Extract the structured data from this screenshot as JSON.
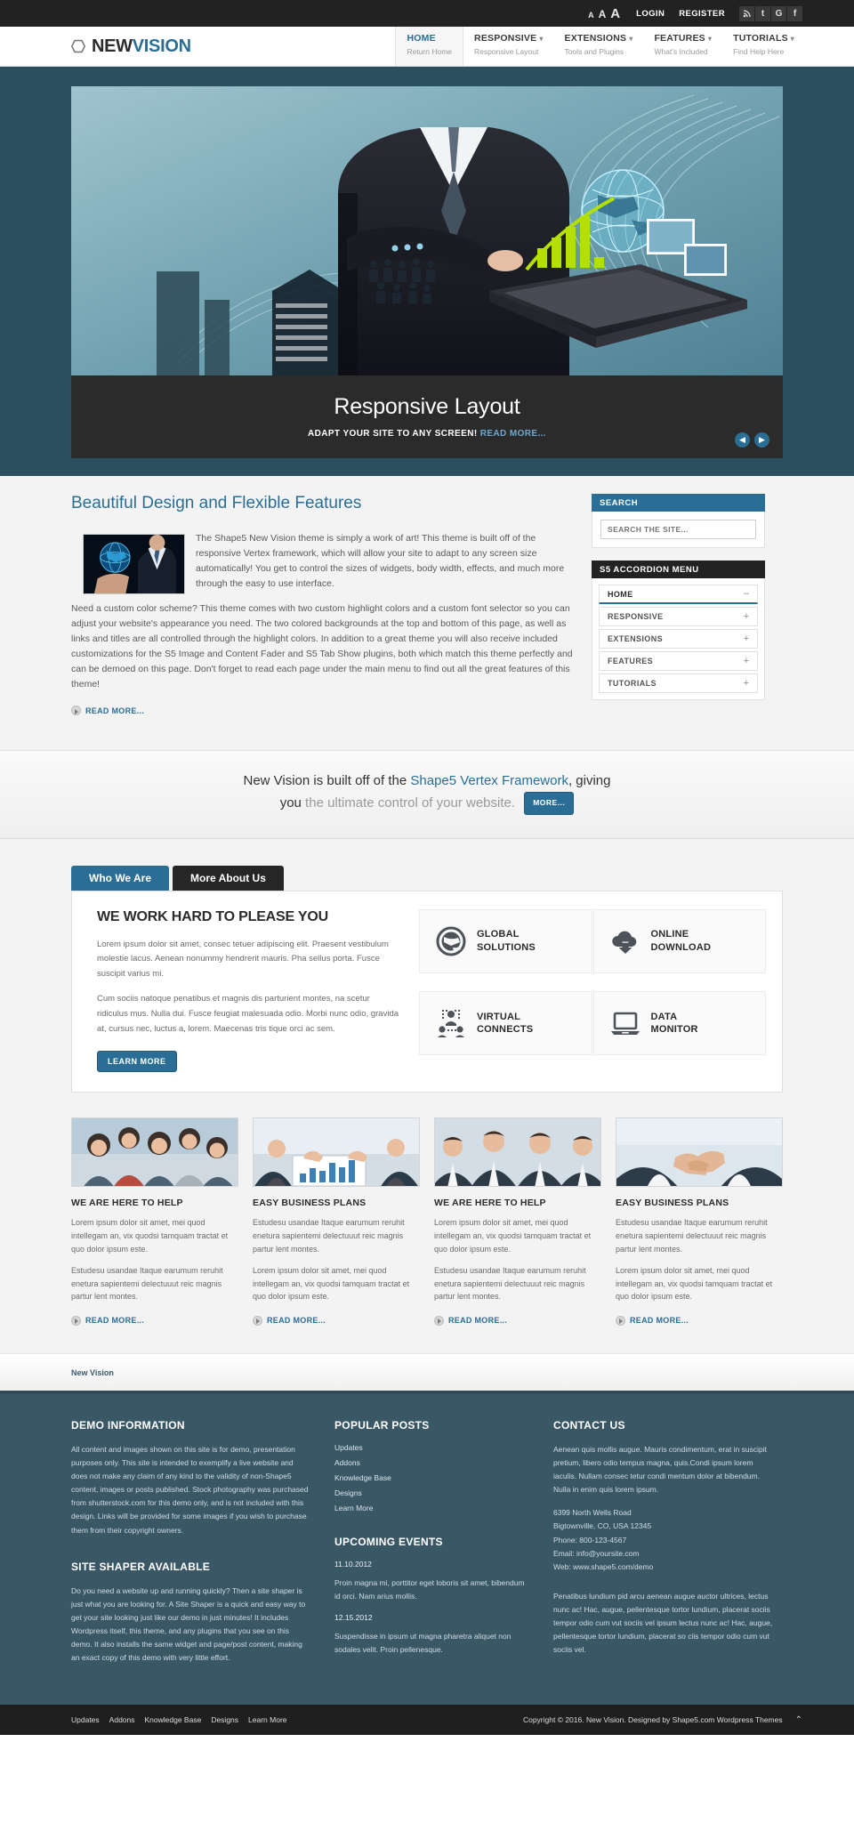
{
  "topbar": {
    "font_sizes": [
      "A",
      "A",
      "A"
    ],
    "login_label": "LOGIN",
    "register_label": "REGISTER",
    "social": [
      {
        "name": "rss-icon",
        "glyph": "◔"
      },
      {
        "name": "twitter-icon",
        "glyph": "t"
      },
      {
        "name": "google-icon",
        "glyph": "G"
      },
      {
        "name": "facebook-icon",
        "glyph": "f"
      }
    ]
  },
  "header": {
    "logo_a": "NEW",
    "logo_b": "VISION",
    "nav": [
      {
        "label": "HOME",
        "sub": "Return Home",
        "caret": false,
        "active": true
      },
      {
        "label": "RESPONSIVE",
        "sub": "Responsive Layout",
        "caret": true,
        "active": false
      },
      {
        "label": "EXTENSIONS",
        "sub": "Tools and Plugins",
        "caret": true,
        "active": false
      },
      {
        "label": "FEATURES",
        "sub": "What's Included",
        "caret": true,
        "active": false
      },
      {
        "label": "TUTORIALS",
        "sub": "Find Help Here",
        "caret": true,
        "active": false
      }
    ]
  },
  "slider": {
    "title": "Responsive Layout",
    "subtitle": "ADAPT YOUR SITE TO ANY SCREEN!",
    "read_more": "READ MORE...",
    "prev": "◀",
    "next": "▶"
  },
  "main": {
    "page_title": "Beautiful Design and Flexible Features",
    "paragraph_1": "The Shape5 New Vision theme is simply a work of art! This theme is built off of the responsive Vertex framework, which will allow your site to adapt to any screen size automatically! You get to control the sizes of widgets, body width, effects, and much more through the easy to use interface.",
    "paragraph_2": "Need a custom color scheme? This theme comes with two custom highlight colors and a custom font selector so you can adjust your website's appearance you need. The two colored backgrounds at the top and bottom of this page, as well as links and titles are all controlled through the highlight colors. In addition to a great theme you will also receive included customizations for the S5 Image and Content Fader and S5 Tab Show plugins, both which match this theme perfectly and can be demoed on this page. Don't forget to read each page under the main menu to find out all the great features of this theme!",
    "read_more": "READ MORE..."
  },
  "sidebar": {
    "search_title": "SEARCH",
    "search_placeholder": "SEARCH THE SITE...",
    "search_value": "",
    "accordion_title": "S5 ACCORDION MENU",
    "accordion_items": [
      {
        "label": "HOME",
        "sign": "–"
      },
      {
        "label": "RESPONSIVE",
        "sign": "+"
      },
      {
        "label": "EXTENSIONS",
        "sign": "+"
      },
      {
        "label": "FEATURES",
        "sign": "+"
      },
      {
        "label": "TUTORIALS",
        "sign": "+"
      }
    ]
  },
  "highlight": {
    "line1_a": "New Vision is built off of the ",
    "line1_link": "Shape5 Vertex Framework",
    "line1_b": ", giving",
    "line2_a": "you",
    "line2_b": " the ultimate control of your website.",
    "button": "MORE..."
  },
  "tabs": {
    "tab_active": "Who We Are",
    "tab_inactive": "More About Us",
    "panel_title": "WE WORK HARD TO PLEASE YOU",
    "panel_p1": "Lorem ipsum dolor sit amet, consec tetuer adipiscing elit. Praesent vestibulum molestie lacus. Aenean nonummy hendrerit mauris. Pha sellus porta. Fusce suscipit varius mi.",
    "panel_p2": "Cum sociis natoque penatibus et magnis dis parturient montes, na scetur ridiculus mus. Nulla dui. Fusce feugiat malesuada odio. Morbi nunc odio, gravida at, cursus nec, luctus a, lorem. Maecenas tris tique orci ac sem.",
    "learn_more": "LEARN MORE",
    "features": [
      {
        "icon": "globe-icon",
        "line1": "GLOBAL",
        "line2": "SOLUTIONS"
      },
      {
        "icon": "cloud-download-icon",
        "line1": "ONLINE",
        "line2": "DOWNLOAD"
      },
      {
        "icon": "users-network-icon",
        "line1": "VIRTUAL",
        "line2": "CONNECTS"
      },
      {
        "icon": "laptop-icon",
        "line1": "DATA",
        "line2": "MONITOR"
      }
    ]
  },
  "blog": {
    "read_more": "READ MORE...",
    "columns": [
      {
        "image": "group-selfie-photo",
        "title": "WE ARE HERE TO HELP",
        "p1": "Lorem ipsum dolor sit amet, mei quod intellegam an, vix quodsi tamquam tractat et quo dolor ipsum este.",
        "p2": "Estudesu usandae Itaque earumum reruhit enetura sapientemi delectuuut reic magnis partur lent montes."
      },
      {
        "image": "meeting-chart-photo",
        "title": "EASY BUSINESS PLANS",
        "p1": "Estudesu usandae Itaque earumum reruhit enetura sapientemi delectuuut reic magnis partur lent montes.",
        "p2": "Lorem ipsum dolor sit amet, mei quod intellegam an, vix quodsi tamquam tractat et quo dolor ipsum este."
      },
      {
        "image": "business-team-photo",
        "title": "WE ARE HERE TO HELP",
        "p1": "Lorem ipsum dolor sit amet, mei quod intellegam an, vix quodsi tamquam tractat et quo dolor ipsum este.",
        "p2": "Estudesu usandae Itaque earumum reruhit enetura sapientemi delectuuut reic magnis partur lent montes."
      },
      {
        "image": "handshake-photo",
        "title": "EASY BUSINESS PLANS",
        "p1": "Estudesu usandae Itaque earumum reruhit enetura sapientemi delectuuut reic magnis partur lent montes.",
        "p2": "Lorem ipsum dolor sit amet, mei quod intellegam an, vix quodsi tamquam tractat et quo dolor ipsum este."
      }
    ]
  },
  "breadcrumb": {
    "text": "New Vision"
  },
  "footer": {
    "demo_title": "DEMO INFORMATION",
    "demo_text": "All content and images shown on this site is for demo, presentation purposes only. This site is intended to exemplify a live website and does not make any claim of any kind to the validity of non-Shape5 content, images or posts published. Stock photography was purchased from shutterstock.com for this demo only, and is not included with this design. Links will be provided for some images if you wish to purchase them from their copyright owners.",
    "shaper_title": "SITE SHAPER AVAILABLE",
    "shaper_text": "Do you need a website up and running quickly? Then a site shaper is just what you are looking for. A Site Shaper is a quick and easy way to get your site looking just like our demo in just minutes! It includes Wordpress itself, this theme, and any plugins that you see on this demo. It also installs the same widget and page/post content, making an exact copy of this demo with very little effort.",
    "popular_title": "POPULAR POSTS",
    "popular_links": [
      "Updates",
      "Addons",
      "Knowledge Base",
      "Designs",
      "Learn More"
    ],
    "events_title": "UPCOMING EVENTS",
    "events": [
      {
        "date": "11.10.2012",
        "text": "Proin magna mi, porttitor eget loboris sit amet, bibendum id orci. Nam arius mollis."
      },
      {
        "date": "12.15.2012",
        "text": "Suspendisse in ipsum ut magna pharetra aliquet non sodales velit. Proin pellenesque."
      }
    ],
    "contact_title": "CONTACT US",
    "contact_text": "Aenean quis mollis augue. Mauris condimentum, erat in suscipit pretium, libero odio tempus magna, quis.Condi ipsum lorem iaculis. Nullam consec tetur condi mentum dolor at bibendum. Nulla in enim quis lorem ipsum.",
    "address_line1": "6399 North Wells Road",
    "address_line2": "Bigtownville, CO, USA 12345",
    "address_line3": "Phone: 800-123-4567",
    "address_line4": "Email: info@yoursite.com",
    "address_line5": "Web: www.shape5.com/demo",
    "contact_text2": "Penatibus lundium pid arcu aenean augue auctor ultrices, lectus nunc ac! Hac, augue, pellentesque tortor lundium, placerat sociis tempor odio cum vut sociis vel ipsum lectus nunc ac! Hac, augue, pellentesque tortor lundium, placerat so ciis tempor odio cum vut sociis vel."
  },
  "bottombar": {
    "links": [
      "Updates",
      "Addons",
      "Knowledge Base",
      "Designs",
      "Learn More"
    ],
    "copyright": "Copyright © 2016. New Vision. Designed by Shape5.com Wordpress Themes",
    "to_top": "⌃"
  },
  "colors": {
    "accent_blue": "#2a6e96",
    "dark": "#222222",
    "footer_blue": "#3a5766",
    "band_grey": "#f3f3f3"
  }
}
